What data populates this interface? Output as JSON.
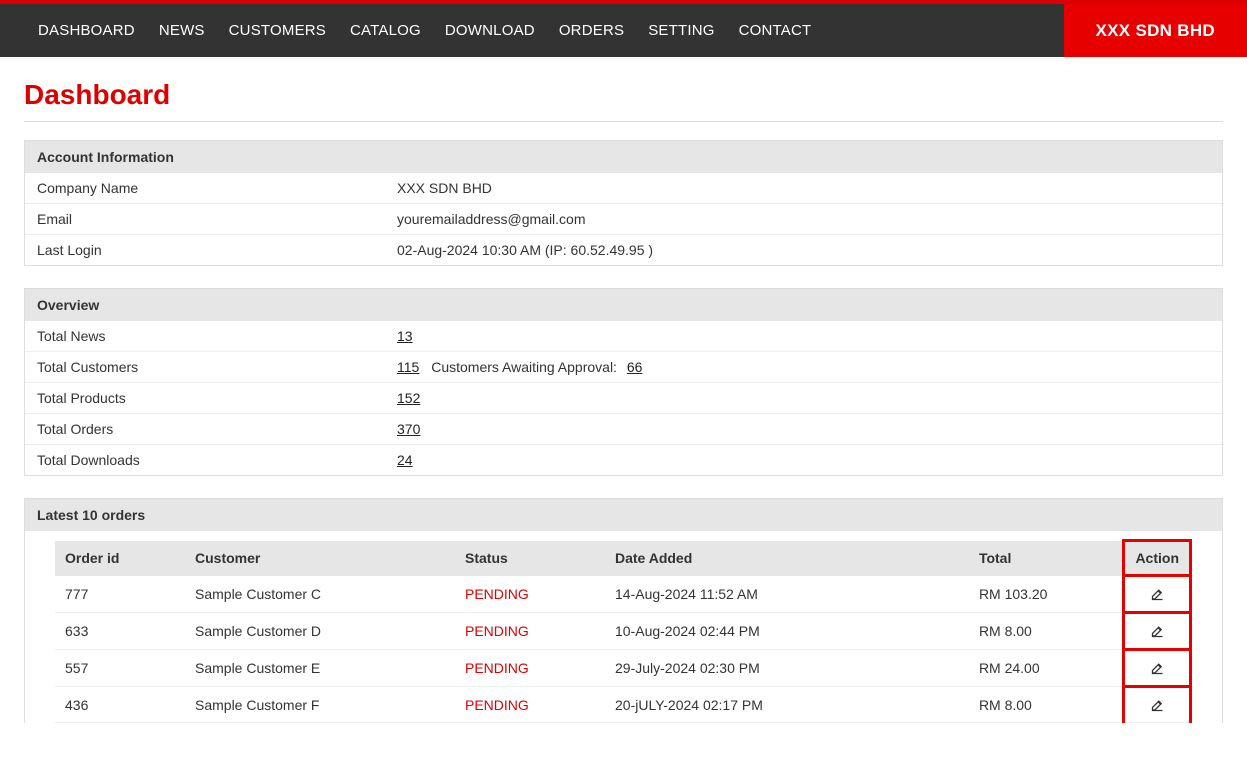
{
  "nav": {
    "items": [
      {
        "label": "DASHBOARD"
      },
      {
        "label": "NEWS"
      },
      {
        "label": "CUSTOMERS"
      },
      {
        "label": "CATALOG"
      },
      {
        "label": "DOWNLOAD"
      },
      {
        "label": "ORDERS"
      },
      {
        "label": "SETTING"
      },
      {
        "label": "CONTACT"
      }
    ],
    "company": "XXX SDN BHD"
  },
  "page": {
    "title": "Dashboard"
  },
  "account": {
    "header": "Account Information",
    "companyLabel": "Company Name",
    "companyValue": "XXX SDN BHD",
    "emailLabel": "Email",
    "emailValue": "youremailaddress@gmail.com",
    "lastLoginLabel": "Last Login",
    "lastLoginValue": "02-Aug-2024 10:30 AM  (IP: 60.52.49.95 )"
  },
  "overview": {
    "header": "Overview",
    "rows": [
      {
        "label": "Total News",
        "value": "13"
      },
      {
        "label": "Total Customers",
        "value": "115",
        "afterText": "Customers Awaiting Approval:",
        "afterLink": "66"
      },
      {
        "label": "Total Products",
        "value": "152"
      },
      {
        "label": "Total Orders",
        "value": "370"
      },
      {
        "label": "Total Downloads",
        "value": "24"
      }
    ]
  },
  "orders": {
    "header": "Latest 10 orders",
    "columns": {
      "orderId": "Order id",
      "customer": "Customer",
      "status": "Status",
      "dateAdded": "Date Added",
      "total": "Total",
      "action": "Action"
    },
    "rows": [
      {
        "orderId": "777",
        "customer": "Sample Customer C",
        "status": "PENDING",
        "dateAdded": "14-Aug-2024 11:52 AM",
        "total": "RM 103.20"
      },
      {
        "orderId": "633",
        "customer": "Sample Customer D",
        "status": "PENDING",
        "dateAdded": "10-Aug-2024 02:44 PM",
        "total": "RM 8.00"
      },
      {
        "orderId": "557",
        "customer": "Sample Customer E",
        "status": "PENDING",
        "dateAdded": "29-July-2024 02:30 PM",
        "total": "RM 24.00"
      },
      {
        "orderId": "436",
        "customer": "Sample Customer F",
        "status": "PENDING",
        "dateAdded": "20-jULY-2024 02:17 PM",
        "total": "RM 8.00"
      }
    ]
  }
}
